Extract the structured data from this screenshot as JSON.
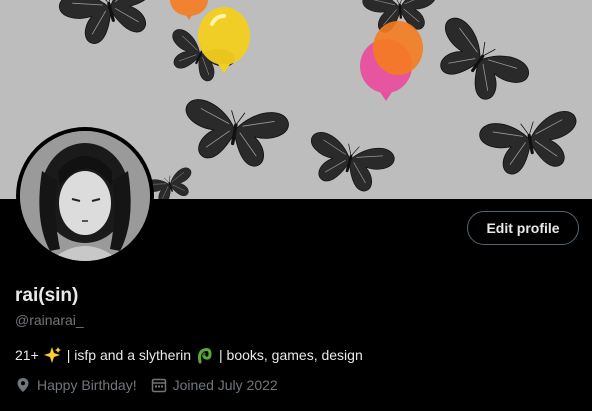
{
  "profile": {
    "display_name": "rai(sin)",
    "handle": "@rainarai_",
    "bio": {
      "prefix": "21+",
      "sparkle_icon": "sparkles-emoji",
      "middle": "| isfp and a slytherin",
      "snake_icon": "snake-emoji",
      "suffix": "| books, games, design"
    },
    "location": "Happy Birthday!",
    "joined": "Joined July 2022",
    "edit_label": "Edit profile"
  },
  "icons": {
    "location": "location-pin-icon",
    "calendar": "calendar-icon"
  },
  "colors": {
    "background": "#000000",
    "text": "#e7e9ea",
    "muted": "#71767b",
    "button_border": "#536471",
    "balloon_pink": "#e0187c",
    "balloon_blue": "#1a6fb0",
    "balloon_orange": "#f57c1f",
    "balloon_yellow": "#f2cf1d"
  }
}
